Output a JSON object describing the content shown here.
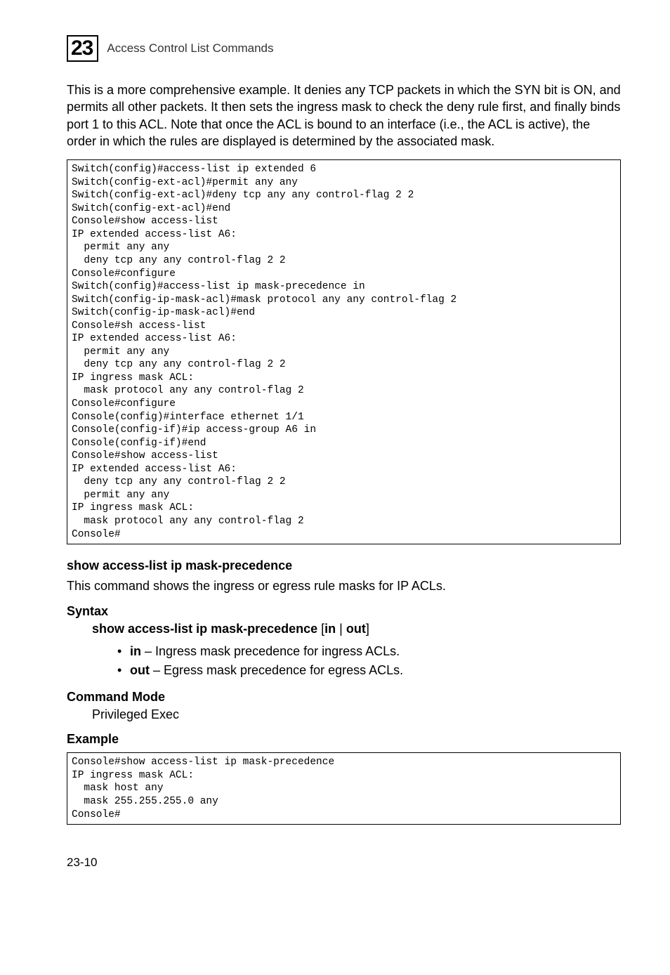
{
  "header": {
    "chapter_number": "23",
    "title": "Access Control List Commands"
  },
  "intro_para": "This is a more comprehensive example. It denies any TCP packets in which the SYN bit is ON, and permits all other packets. It then sets the ingress mask to check the deny rule first, and finally binds port 1 to this ACL. Note that once the ACL is bound to an interface (i.e., the ACL is active), the order in which the rules are displayed is determined by the associated mask.",
  "code_block_1": "Switch(config)#access-list ip extended 6\nSwitch(config-ext-acl)#permit any any\nSwitch(config-ext-acl)#deny tcp any any control-flag 2 2\nSwitch(config-ext-acl)#end\nConsole#show access-list\nIP extended access-list A6:\n  permit any any\n  deny tcp any any control-flag 2 2\nConsole#configure\nSwitch(config)#access-list ip mask-precedence in\nSwitch(config-ip-mask-acl)#mask protocol any any control-flag 2\nSwitch(config-ip-mask-acl)#end\nConsole#sh access-list\nIP extended access-list A6:\n  permit any any\n  deny tcp any any control-flag 2 2\nIP ingress mask ACL:\n  mask protocol any any control-flag 2\nConsole#configure\nConsole(config)#interface ethernet 1/1\nConsole(config-if)#ip access-group A6 in\nConsole(config-if)#end\nConsole#show access-list\nIP extended access-list A6:\n  deny tcp any any control-flag 2 2\n  permit any any\nIP ingress mask ACL:\n  mask protocol any any control-flag 2\nConsole#",
  "cmd_heading": "show access-list ip mask-precedence",
  "cmd_desc": "This command shows the ingress or egress rule masks for IP ACLs.",
  "syntax_label": "Syntax",
  "syntax_cmd_bold": "show access-list ip mask-precedence",
  "syntax_opt_open": " [",
  "syntax_opt_in": "in",
  "syntax_opt_sep": " | ",
  "syntax_opt_out": "out",
  "syntax_opt_close": "]",
  "opts": [
    {
      "kw": "in",
      "text": " – Ingress mask precedence for ingress ACLs."
    },
    {
      "kw": "out",
      "text": " – Egress mask precedence for egress ACLs."
    }
  ],
  "mode_label": "Command Mode",
  "mode_value": "Privileged Exec",
  "example_label": "Example",
  "code_block_2": "Console#show access-list ip mask-precedence\nIP ingress mask ACL:\n  mask host any\n  mask 255.255.255.0 any\nConsole#",
  "footer": "23-10"
}
